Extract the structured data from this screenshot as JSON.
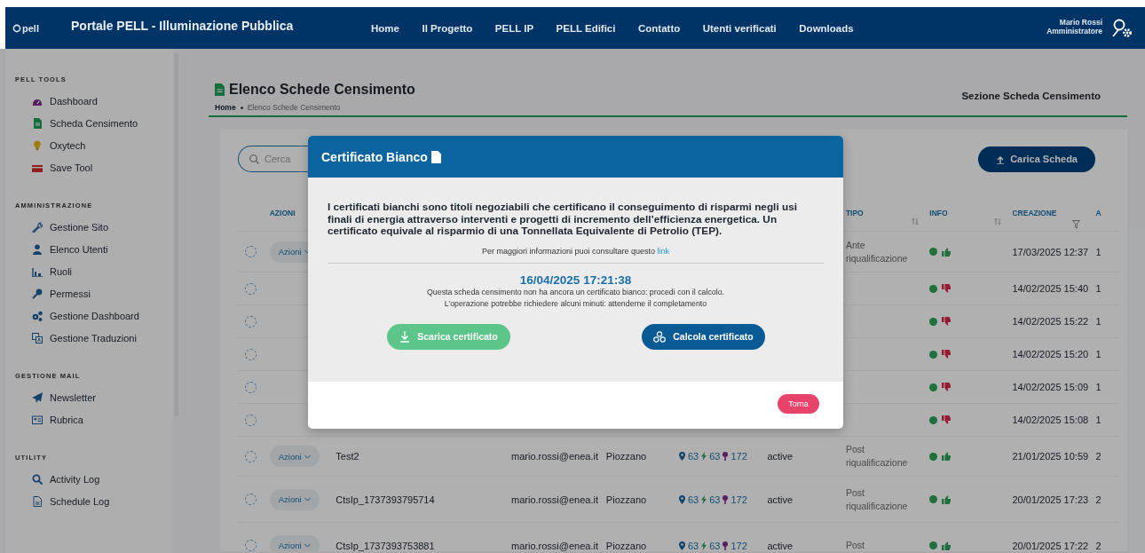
{
  "header": {
    "logo": "pell",
    "title": "Portale PELL - Illuminazione Pubblica",
    "nav": [
      "Home",
      "Il Progetto",
      "PELL IP",
      "PELL Edifici",
      "Contatto",
      "Utenti verificati",
      "Downloads"
    ],
    "user": {
      "name": "Mario Rossi",
      "role": "Amministratore"
    }
  },
  "sidebar": {
    "sections": [
      {
        "title": "PELL TOOLS",
        "items": [
          "Dashboard",
          "Scheda Censimento",
          "Oxytech",
          "Save Tool"
        ]
      },
      {
        "title": "AMMINISTRAZIONE",
        "items": [
          "Gestione Sito",
          "Elenco Utenti",
          "Ruoli",
          "Permessi",
          "Gestione Dashboard",
          "Gestione Traduzioni"
        ]
      },
      {
        "title": "GESTIONE MAIL",
        "items": [
          "Newsletter",
          "Rubrica"
        ]
      },
      {
        "title": "UTILITY",
        "items": [
          "Activity Log",
          "Schedule Log"
        ]
      }
    ]
  },
  "page": {
    "title": "Elenco Schede Censimento",
    "breadcrumb": [
      "Home",
      "Elenco Schede Censimento"
    ],
    "section": "Sezione Scheda Censimento"
  },
  "toolbar": {
    "search": {
      "placeholder": "Cerca"
    },
    "upload_button": "Carica Scheda"
  },
  "table": {
    "columns": {
      "azioni": "AZIONI",
      "tipo": "TIPO",
      "info": "INFO",
      "creazione": "CREAZIONE",
      "column_10": "A"
    },
    "rows": [
      {
        "checked": false,
        "actions": "Azioni",
        "tipo": "Ante riqualificazione",
        "approved": true,
        "created": "17/03/2025 12:37",
        "column_10": "1"
      },
      {
        "checked": false,
        "approved": false,
        "created": "14/02/2025 15:40",
        "column_10": "1"
      },
      {
        "checked": false,
        "approved": false,
        "created": "14/02/2025 15:22",
        "column_10": "1"
      },
      {
        "checked": false,
        "approved": false,
        "created": "14/02/2025 15:20",
        "column_10": "1"
      },
      {
        "checked": false,
        "approved": false,
        "created": "14/02/2025 15:09",
        "column_10": "1"
      },
      {
        "checked": false,
        "approved": false,
        "created": "14/02/2025 15:08",
        "column_10": "1"
      },
      {
        "checked": false,
        "actions": "Azioni",
        "name": "Test2",
        "email": "mario.rossi@enea.it",
        "city": "Piozzano",
        "counts": [
          "63",
          "63",
          "172"
        ],
        "status": "active",
        "tipo": "Post riqualificazione",
        "approved": true,
        "created": "21/01/2025 10:59",
        "column_10": "2"
      },
      {
        "checked": false,
        "actions": "Azioni",
        "name": "CtsIp_1737393795714",
        "email": "mario.rossi@enea.it",
        "city": "Piozzano",
        "counts": [
          "63",
          "63",
          "172"
        ],
        "status": "active",
        "tipo": "Post riqualificazione",
        "approved": true,
        "created": "20/01/2025 17:23",
        "column_10": "2"
      },
      {
        "checked": false,
        "actions": "Azioni",
        "name": "CtsIp_1737393753881",
        "email": "mario.rossi@enea.it",
        "city": "Piozzano",
        "counts": [
          "63",
          "63",
          "172"
        ],
        "status": "active",
        "tipo": "Post",
        "approved": true,
        "created": "20/01/2025 17:22",
        "column_10": "2"
      }
    ]
  },
  "modal": {
    "title": "Certificato Bianco",
    "description": "I certificati bianchi sono titoli negoziabili che certificano il conseguimento di risparmi negli usi finali di energia attraverso interventi e progetti di incremento dell’efficienza energetica. Un certificato equivale al risparmio di una Tonnellata Equivalente di Petrolio (TEP).",
    "info_text": "Per maggiori informazioni puoi consultare questo",
    "info_link": "link",
    "timestamp": "16/04/2025 17:21:38",
    "message_lines": [
      "Questa scheda censimento non ha ancora un certificato bianco: procedi con il calcolo.",
      "L’operazione potrebbe richiedere alcuni minuti: attenderne il completamento"
    ],
    "buttons": [
      {
        "kind": "download",
        "label": "Scarica certificato"
      },
      {
        "kind": "calculate",
        "label": "Calcola certificato"
      }
    ],
    "close_button": "Torna"
  }
}
